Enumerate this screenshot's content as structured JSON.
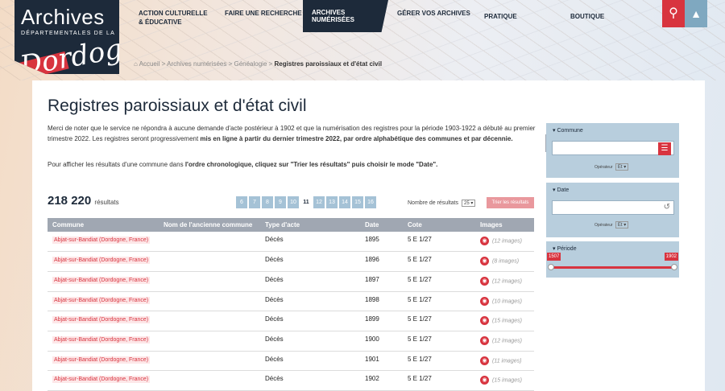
{
  "logo": {
    "line1": "Archives",
    "line2": "DÉPARTEMENTALES DE LA",
    "line3": "Dordogne"
  },
  "nav": {
    "items": [
      "ACTION CULTURELLE & ÉDUCATIVE",
      "FAIRE UNE RECHERCHE",
      "ARCHIVES NUMÉRISÉES",
      "GÉRER VOS ARCHIVES",
      "PRATIQUE",
      "BOUTIQUE"
    ],
    "search_icon": "search-icon",
    "up_icon": "arrow-up-icon"
  },
  "breadcrumb": {
    "home": "Accueil",
    "sep1": "Archives numérisées",
    "sep2": "Généalogie",
    "current": "Registres paroissiaux et d'état civil"
  },
  "page": {
    "title": "Registres paroissiaux et d'état civil",
    "intro_a": "Merci de noter que le service ne répondra à aucune demande d'acte postérieur à 1902 et que la numérisation des registres pour la période 1903-1922 a débuté au premier trimestre 2022. Les registres seront progressivement ",
    "intro_b": "mis en ligne à partir du dernier trimestre 2022, par ordre alphabétique des communes et par décennie.",
    "intro2_a": "Pour afficher les résultats d'une commune dans ",
    "intro2_b": "l'ordre chronologique, cliquez sur \"Trier les résultats\" puis choisir le mode \"Date\".",
    "count": "218 220",
    "count_label": "résultats",
    "pages": [
      "6",
      "7",
      "8",
      "9",
      "10",
      "11",
      "12",
      "13",
      "14",
      "15",
      "16"
    ],
    "current_page": "11",
    "per_page_label": "Nombre de résultats",
    "per_page_value": "25",
    "sort_button": "Trier les résultats"
  },
  "table": {
    "headers": [
      "Commune",
      "Nom de l'ancienne commune",
      "Type d'acte",
      "Date",
      "Cote",
      "Images"
    ],
    "rows": [
      {
        "commune": "Abjat-sur-Bandiat (Dordogne, France)",
        "ancienne": "",
        "type": "Décès",
        "date": "1895",
        "cote": "5 E 1/27",
        "images": "(12 images)"
      },
      {
        "commune": "Abjat-sur-Bandiat (Dordogne, France)",
        "ancienne": "",
        "type": "Décès",
        "date": "1896",
        "cote": "5 E 1/27",
        "images": "(8 images)"
      },
      {
        "commune": "Abjat-sur-Bandiat (Dordogne, France)",
        "ancienne": "",
        "type": "Décès",
        "date": "1897",
        "cote": "5 E 1/27",
        "images": "(12 images)"
      },
      {
        "commune": "Abjat-sur-Bandiat (Dordogne, France)",
        "ancienne": "",
        "type": "Décès",
        "date": "1898",
        "cote": "5 E 1/27",
        "images": "(10 images)"
      },
      {
        "commune": "Abjat-sur-Bandiat (Dordogne, France)",
        "ancienne": "",
        "type": "Décès",
        "date": "1899",
        "cote": "5 E 1/27",
        "images": "(15 images)"
      },
      {
        "commune": "Abjat-sur-Bandiat (Dordogne, France)",
        "ancienne": "",
        "type": "Décès",
        "date": "1900",
        "cote": "5 E 1/27",
        "images": "(12 images)"
      },
      {
        "commune": "Abjat-sur-Bandiat (Dordogne, France)",
        "ancienne": "",
        "type": "Décès",
        "date": "1901",
        "cote": "5 E 1/27",
        "images": "(11 images)"
      },
      {
        "commune": "Abjat-sur-Bandiat (Dordogne, France)",
        "ancienne": "",
        "type": "Décès",
        "date": "1902",
        "cote": "5 E 1/27",
        "images": "(15 images)"
      }
    ]
  },
  "sidebar": {
    "commune_title": "Commune",
    "operator_label": "Opérateur",
    "operator_value": "Et",
    "date_title": "Date",
    "period_title": "Période",
    "period_min": "1507",
    "period_max": "1902"
  },
  "colors": {
    "accent": "#d8343f",
    "navy": "#1d2a3a",
    "panel": "#b8cedd"
  }
}
